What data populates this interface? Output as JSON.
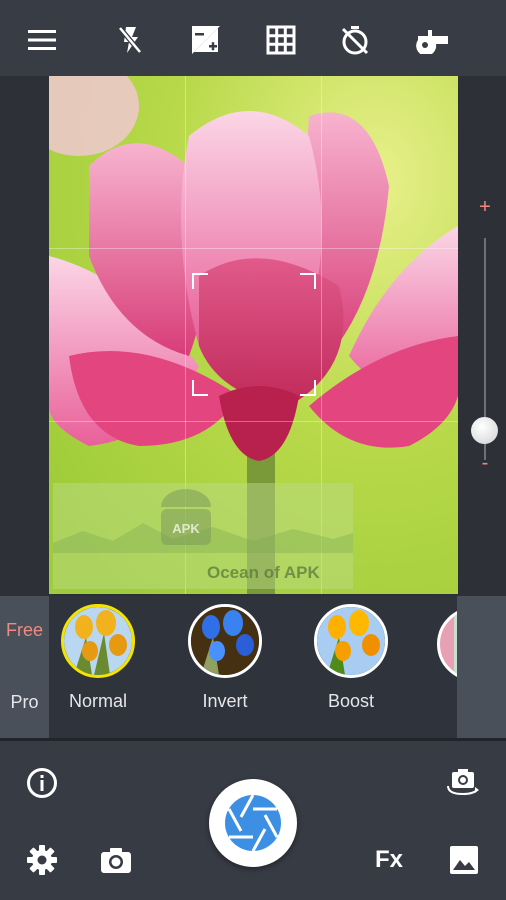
{
  "toolbar": {
    "icons": [
      "menu-icon",
      "flash-off-icon",
      "exposure-icon",
      "grid-icon",
      "timer-off-icon",
      "whistle-icon"
    ]
  },
  "zoom": {
    "plus_label": "+",
    "minus_label": "-",
    "level": 0.0
  },
  "watermark": {
    "text": "Ocean of APK",
    "logo_text": "APK"
  },
  "filter_panel": {
    "tabs": [
      {
        "label": "Free",
        "active": true
      },
      {
        "label": "Pro",
        "active": false
      }
    ],
    "filters": [
      {
        "label": "Normal",
        "selected": true
      },
      {
        "label": "Invert",
        "selected": false
      },
      {
        "label": "Boost",
        "selected": false
      }
    ]
  },
  "bottom_bar": {
    "fx_label": "Fx",
    "icons": [
      "info-icon",
      "switch-camera-icon",
      "settings-icon",
      "camera-mode-icon",
      "shutter-icon",
      "gallery-icon"
    ]
  },
  "colors": {
    "accent": "#f08a80",
    "selected_ring": "#f5e400",
    "shutter_blue": "#3d8fe3"
  }
}
